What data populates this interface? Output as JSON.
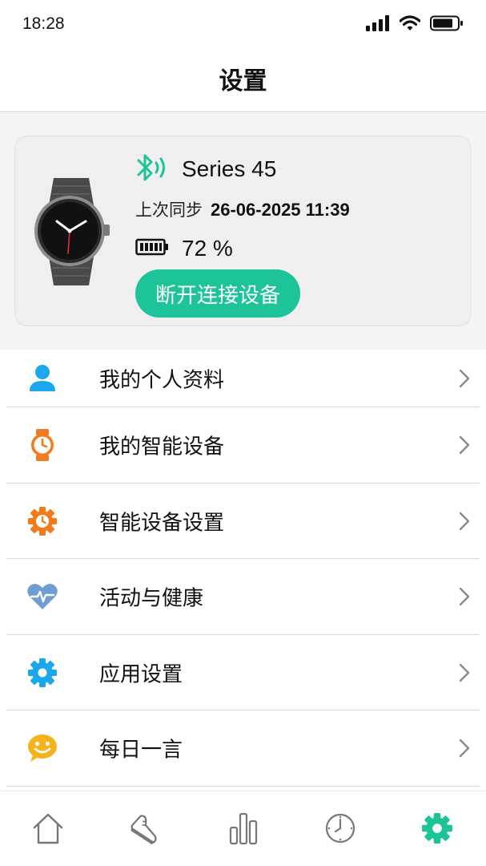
{
  "status_bar": {
    "time": "18:28",
    "icons": [
      "signal-icon",
      "wifi-icon",
      "battery-icon"
    ]
  },
  "header": {
    "title": "设置"
  },
  "device": {
    "name": "Series 45",
    "sync_label": "上次同步",
    "sync_value": "26-06-2025 11:39",
    "battery_text": "72 %",
    "battery_level": 0.72,
    "disconnect_label": "断开连接设备",
    "accent_color": "#1dc499"
  },
  "menu": {
    "items": [
      {
        "label": "我的个人资料",
        "icon": "profile-icon"
      },
      {
        "label": "我的智能设备",
        "icon": "watch-icon"
      },
      {
        "label": "智能设备设置",
        "icon": "device-settings-icon"
      },
      {
        "label": "活动与健康",
        "icon": "heart-pulse-icon"
      },
      {
        "label": "应用设置",
        "icon": "gear-icon"
      },
      {
        "label": "每日一言",
        "icon": "smile-icon"
      }
    ]
  },
  "tabbar": {
    "tabs": [
      "home-icon",
      "shoe-icon",
      "chart-icon",
      "clock-icon",
      "settings-icon"
    ],
    "active": "settings-icon"
  }
}
